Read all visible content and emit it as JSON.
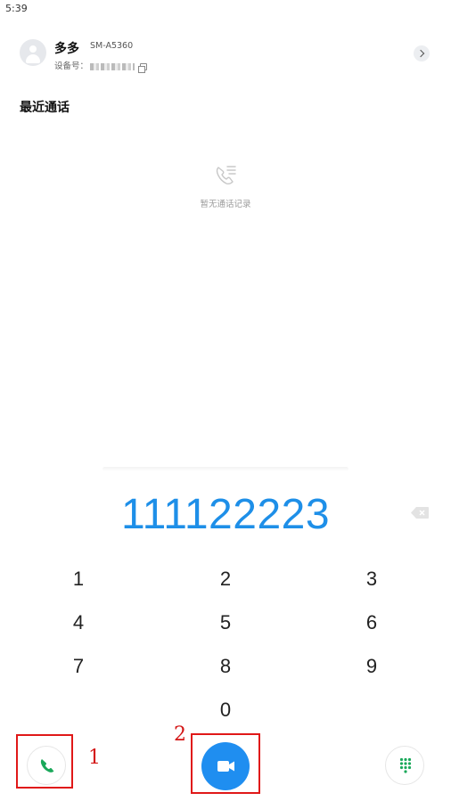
{
  "status_bar": {
    "time": "5:39"
  },
  "device": {
    "name": "多多",
    "model": "SM-A5360",
    "id_label": "设备号："
  },
  "recent": {
    "title": "最近通话",
    "empty_text": "暂无通话记录",
    "empty_icon": "call-log-icon"
  },
  "dialer": {
    "number": "111122223",
    "keys": [
      "1",
      "2",
      "3",
      "4",
      "5",
      "6",
      "7",
      "8",
      "9",
      "0"
    ]
  },
  "actions": {
    "voice_call_icon": "phone-icon",
    "video_call_icon": "video-camera-icon",
    "keypad_icon": "dialpad-icon",
    "accent": "#1f8ef0",
    "call_green": "#1aa85a"
  },
  "annotations": {
    "label_1": "1",
    "label_2": "2",
    "color": "#e01818"
  }
}
